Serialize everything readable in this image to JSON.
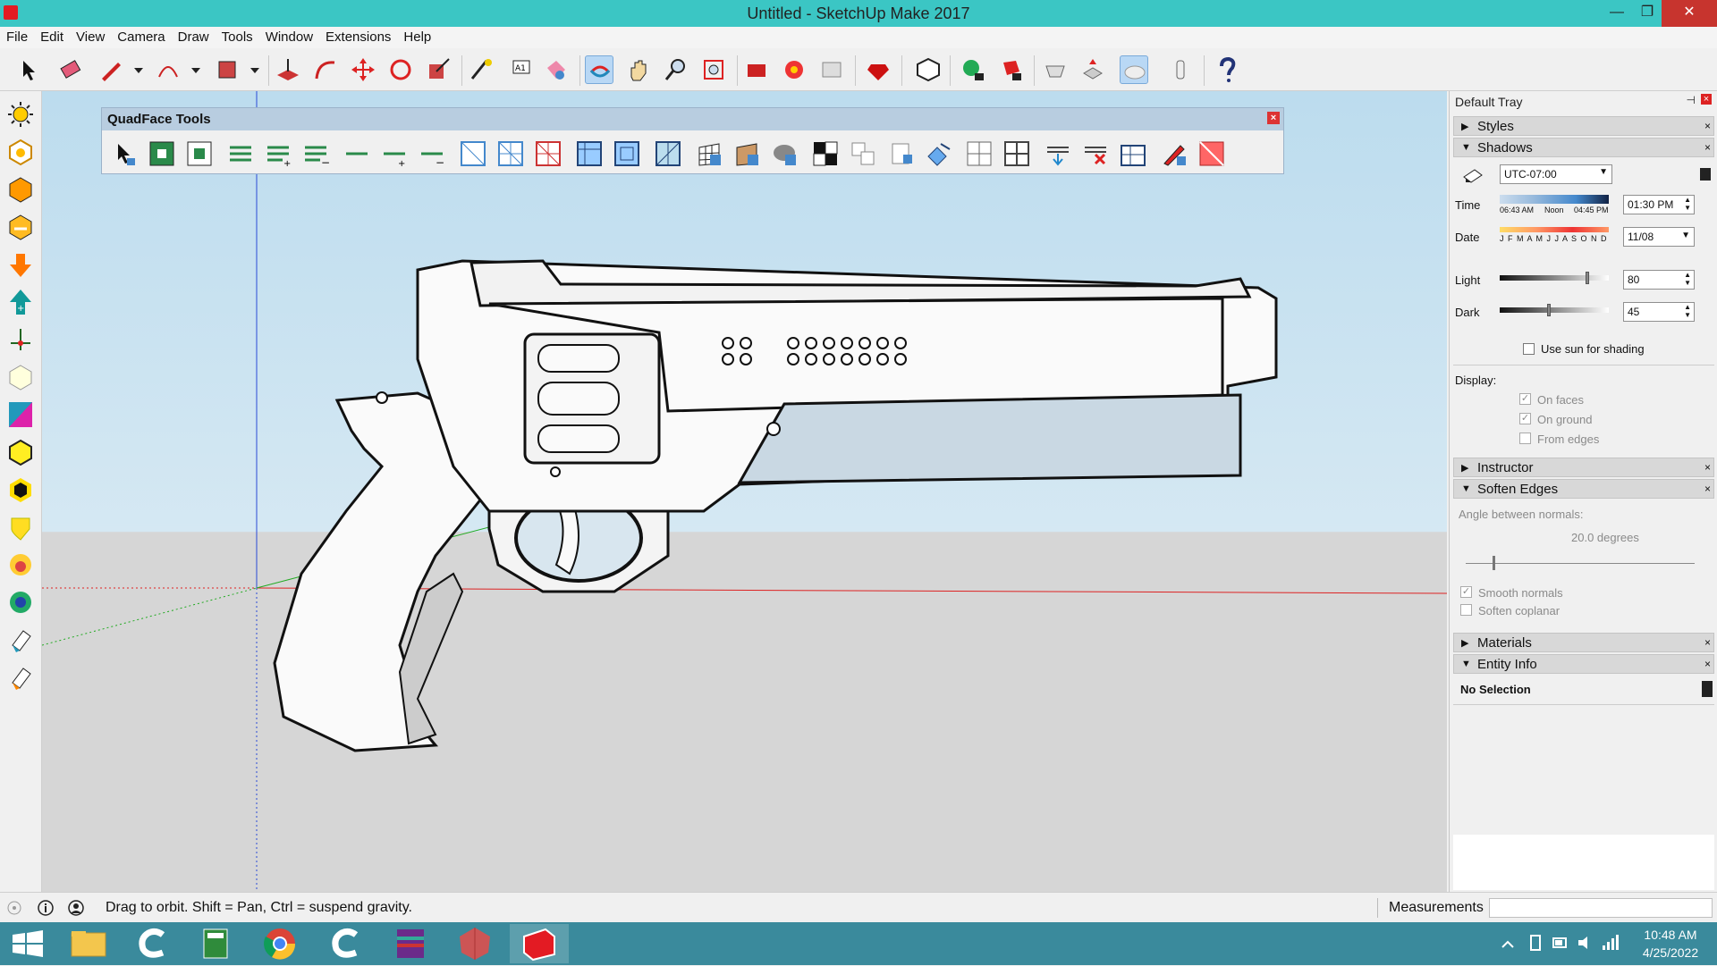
{
  "window": {
    "title": "Untitled - SketchUp Make 2017",
    "minimize": "—",
    "maximize": "❐",
    "close": "✕"
  },
  "menu": [
    "File",
    "Edit",
    "View",
    "Camera",
    "Draw",
    "Tools",
    "Window",
    "Extensions",
    "Help"
  ],
  "quadface": {
    "title": "QuadFace Tools",
    "close": "×"
  },
  "tray": {
    "title": "Default Tray",
    "panels": {
      "styles": "Styles",
      "shadows": "Shadows",
      "instructor": "Instructor",
      "soften_edges": "Soften Edges",
      "materials": "Materials",
      "entity_info": "Entity Info"
    },
    "shadows": {
      "timezone": "UTC-07:00",
      "time_label": "Time",
      "time_ticks": [
        "06:43 AM",
        "Noon",
        "04:45 PM"
      ],
      "time_value": "01:30 PM",
      "date_label": "Date",
      "months": "J F M A M J J A S O N D",
      "date_value": "11/08",
      "light_label": "Light",
      "light_value": "80",
      "light_level": 0.8,
      "dark_label": "Dark",
      "dark_value": "45",
      "dark_level": 0.45,
      "use_sun": "Use sun for shading",
      "display_label": "Display:",
      "on_faces": "On faces",
      "on_ground": "On ground",
      "from_edges": "From edges"
    },
    "soften": {
      "angle_label": "Angle between normals:",
      "angle_value": "20.0  degrees",
      "smooth_normals": "Smooth normals",
      "soften_coplanar": "Soften coplanar"
    },
    "entity": {
      "selection": "No Selection"
    }
  },
  "status": {
    "text": "Drag to orbit. Shift = Pan, Ctrl = suspend gravity.",
    "measurements": "Measurements"
  },
  "taskbar": {
    "time": "10:48 AM",
    "date": "4/25/2022"
  },
  "colors": {
    "titlebar": "#3bc6c4",
    "taskbar": "#3a8a9c",
    "close": "#c7342e"
  }
}
